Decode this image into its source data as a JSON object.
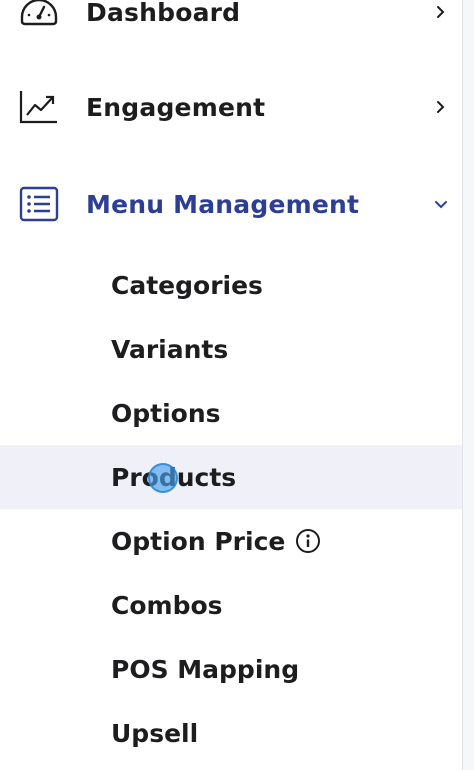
{
  "sidebar": {
    "items": [
      {
        "label": "Dashboard",
        "icon": "gauge-icon",
        "expanded": false
      },
      {
        "label": "Engagement",
        "icon": "trending-chart-icon",
        "expanded": false
      },
      {
        "label": "Menu Management",
        "icon": "list-icon",
        "expanded": true,
        "active": true
      }
    ],
    "submenu": [
      {
        "label": "Categories"
      },
      {
        "label": "Variants"
      },
      {
        "label": "Options"
      },
      {
        "label": "Products",
        "selected": true
      },
      {
        "label": "Option Price",
        "info": true
      },
      {
        "label": "Combos"
      },
      {
        "label": "POS Mapping"
      },
      {
        "label": "Upsell"
      }
    ]
  },
  "colors": {
    "active": "#2c3f95",
    "text": "#1d1d1f",
    "selected_bg": "#f0f1f8",
    "cursor": "#46a0eb"
  }
}
